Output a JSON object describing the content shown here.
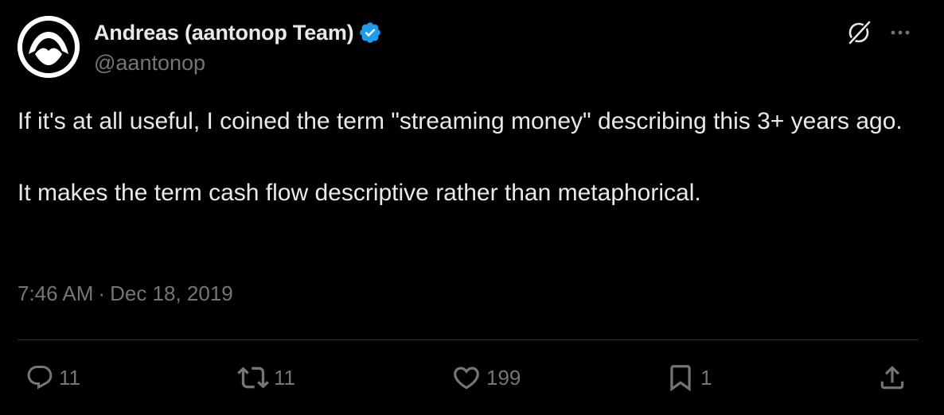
{
  "author": {
    "display_name": "Andreas (aantonop Team)",
    "handle": "@aantonop",
    "verified": true
  },
  "tweet": {
    "text": "If it's at all useful, I coined the term \"streaming money\" describing this 3+ years ago.\n\nIt makes the term cash flow descriptive rather than metaphorical.",
    "time": "7:46 AM",
    "separator": "·",
    "date": "Dec 18, 2019"
  },
  "actions": {
    "reply_count": "11",
    "retweet_count": "11",
    "like_count": "199",
    "bookmark_count": "1"
  },
  "icons": {
    "header": [
      "grok-icon",
      "more-options-icon"
    ],
    "action_bar": [
      "reply-icon",
      "retweet-icon",
      "like-icon",
      "bookmark-icon",
      "share-icon"
    ]
  },
  "colors": {
    "background": "#000000",
    "text": "#e7e9ea",
    "secondary_text": "#71767b",
    "verified_badge": "#1d9bf0",
    "divider": "#2f3336"
  }
}
